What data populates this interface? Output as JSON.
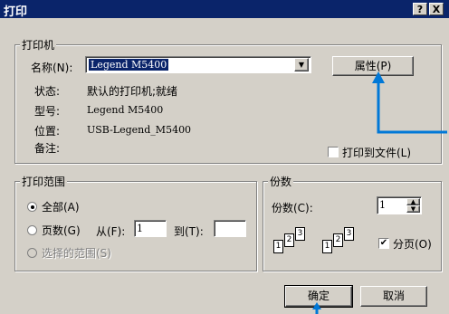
{
  "window": {
    "title": "打印",
    "help_button": "?",
    "close_button": "X"
  },
  "printer": {
    "group_label": "打印机",
    "name_label": "名称(N):",
    "name_value": "Legend M5400",
    "properties_button": "属性(P)",
    "status_label": "状态:",
    "status_value": "默认的打印机;就绪",
    "type_label": "型号:",
    "type_value": "Legend M5400",
    "location_label": "位置:",
    "location_value": "USB-Legend_M5400",
    "comment_label": "备注:",
    "print_to_file_label": "打印到文件(L)",
    "print_to_file_checked": false
  },
  "range": {
    "group_label": "打印范围",
    "all_label": "全部(A)",
    "pages_label": "页数(G)",
    "from_label": "从(F):",
    "from_value": "1",
    "to_label": "到(T):",
    "to_value": "",
    "selection_label": "选择的范围(S)",
    "selected": "all"
  },
  "copies": {
    "group_label": "份数",
    "count_label": "份数(C):",
    "count_value": "1",
    "collate_label": "分页(O)",
    "collate_checked": true,
    "stack1": [
      "1",
      "2",
      "3"
    ],
    "stack2": [
      "1",
      "2",
      "3"
    ]
  },
  "buttons": {
    "ok": "确定",
    "cancel": "取消"
  },
  "colors": {
    "titlebar": "#0a246a",
    "face": "#d4d0c8",
    "annotation": "#0078d7"
  }
}
